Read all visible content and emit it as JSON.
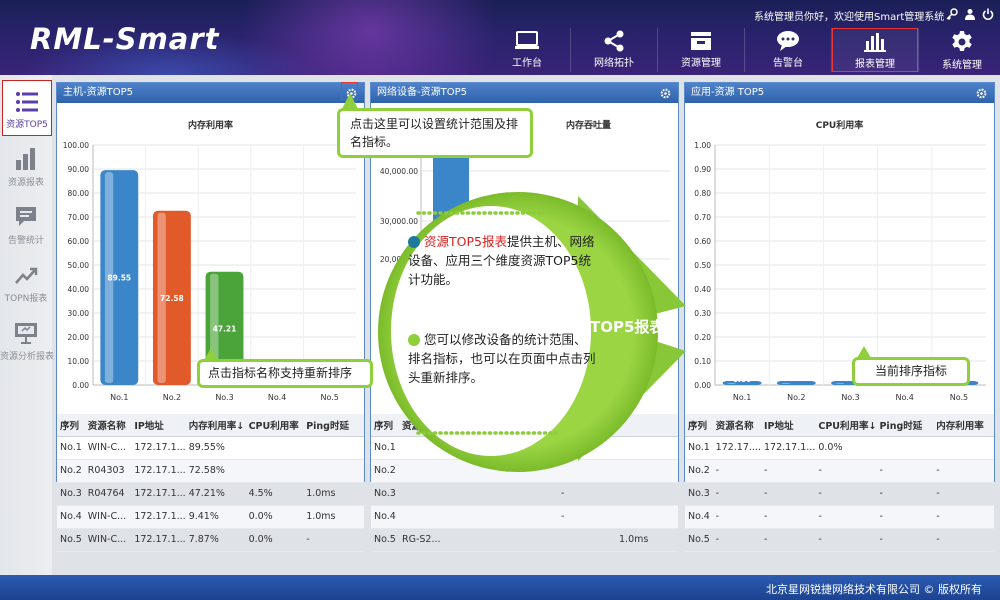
{
  "header": {
    "logo": "RML-Smart",
    "welcome": "系统管理员你好，欢迎使用Smart管理系统",
    "nav": [
      {
        "label": "工作台",
        "icon": "monitor-icon"
      },
      {
        "label": "网络拓扑",
        "icon": "share-icon"
      },
      {
        "label": "资源管理",
        "icon": "inbox-icon"
      },
      {
        "label": "告警台",
        "icon": "chat-icon"
      },
      {
        "label": "报表管理",
        "icon": "bar-chart-icon",
        "active": true
      },
      {
        "label": "系统管理",
        "icon": "gear-icon"
      }
    ]
  },
  "sidebar": {
    "items": [
      {
        "label": "资源TOP5",
        "icon": "list-icon",
        "active": true
      },
      {
        "label": "资源报表",
        "icon": "bar-chart-icon"
      },
      {
        "label": "告警统计",
        "icon": "message-icon"
      },
      {
        "label": "TOPN报表",
        "icon": "trend-icon"
      },
      {
        "label": "资源分析报表",
        "icon": "presentation-icon"
      }
    ]
  },
  "panels": {
    "host": {
      "title": "主机-资源TOP5",
      "chart_title": "内存利用率",
      "columns": [
        "序列",
        "资源名称",
        "IP地址",
        "内存利用率↓",
        "CPU利用率",
        "Ping时延"
      ],
      "rows": [
        [
          "No.1",
          "WIN-C...",
          "172.17.1...",
          "89.55%",
          "",
          ""
        ],
        [
          "No.2",
          "R04303",
          "172.17.1...",
          "72.58%",
          "",
          ""
        ],
        [
          "No.3",
          "R04764",
          "172.17.1...",
          "47.21%",
          "4.5%",
          "1.0ms"
        ],
        [
          "No.4",
          "WIN-C...",
          "172.17.1...",
          "9.41%",
          "0.0%",
          "1.0ms"
        ],
        [
          "No.5",
          "WIN-C...",
          "172.17.1...",
          "7.87%",
          "0.0%",
          "-"
        ]
      ]
    },
    "network": {
      "title": "网络设备-资源TOP5",
      "chart_title": "内存吞吐量",
      "columns": [
        "序列",
        "资源名称",
        "IP地址",
        "",
        "",
        ""
      ],
      "rows": [
        [
          "No.1",
          "",
          "",
          "",
          "",
          ""
        ],
        [
          "No.2",
          "",
          "",
          "",
          "",
          ""
        ],
        [
          "No.3",
          "",
          "",
          "",
          "-",
          ""
        ],
        [
          "No.4",
          "",
          "",
          "",
          "-",
          ""
        ],
        [
          "No.5",
          "RG-S2...",
          "",
          "",
          "",
          "1.0ms"
        ]
      ]
    },
    "app": {
      "title": "应用-资源 TOP5",
      "chart_title": "CPU利用率",
      "columns": [
        "序列",
        "资源名称",
        "IP地址",
        "CPU利用率↓",
        "Ping时延",
        "内存利用率"
      ],
      "rows": [
        [
          "No.1",
          "172.17....",
          "172.17.1...",
          "0.0%",
          "",
          ""
        ],
        [
          "No.2",
          "-",
          "-",
          "-",
          "-",
          "-"
        ],
        [
          "No.3",
          "-",
          "-",
          "-",
          "-",
          "-"
        ],
        [
          "No.4",
          "-",
          "-",
          "-",
          "-",
          "-"
        ],
        [
          "No.5",
          "-",
          "-",
          "-",
          "-",
          "-"
        ]
      ]
    }
  },
  "chart_data": [
    {
      "type": "bar",
      "title": "内存利用率",
      "categories": [
        "No.1",
        "No.2",
        "No.3",
        "No.4",
        "No.5"
      ],
      "values": [
        89.55,
        72.58,
        47.21,
        9.41,
        7.87
      ],
      "value_labels": [
        "89.55",
        "72.58",
        "47.21",
        "9.41",
        "7.87"
      ],
      "colors": [
        "#3b86c8",
        "#e05a2a",
        "#4aa43a",
        "#b9b62a",
        "#7aa040"
      ],
      "ylim": [
        0,
        100
      ],
      "yticks": [
        "0.00",
        "10.00",
        "20.00",
        "30.00",
        "40.00",
        "50.00",
        "60.00",
        "70.00",
        "80.00",
        "90.00",
        "100.00"
      ],
      "grid": true
    },
    {
      "type": "bar",
      "title": "内存吞吐量",
      "yticks_visible": [
        "40,000.00",
        "30,000.00",
        "20,000.00"
      ],
      "grid": true
    },
    {
      "type": "bar",
      "title": "CPU利用率",
      "categories": [
        "No.1",
        "No.2",
        "No.3",
        "No.4",
        "No.5"
      ],
      "values": [
        0.0,
        0,
        0,
        0,
        0
      ],
      "value_labels": [
        "0.00"
      ],
      "ylim": [
        0,
        1
      ],
      "yticks": [
        "0.00",
        "0.10",
        "0.20",
        "0.30",
        "0.40",
        "0.50",
        "0.60",
        "0.70",
        "0.80",
        "0.90",
        "1.00"
      ],
      "grid": true
    }
  ],
  "callouts": {
    "settings": "点击这里可以设置统计范围及排名指标。",
    "sort": "点击指标名称支持重新排序",
    "current": "当前排序指标",
    "bubble_highlight": "资源TOP5报表",
    "bubble_text1": "提供主机、网络设备、应用三个维度资源TOP5统计功能。",
    "bubble_text2": "您可以修改设备的统计范围、排名指标，也可以在页面中点击列头重新排序。",
    "banner": "资源TOP5报表"
  },
  "footer": "北京星网锐捷网络技术有限公司 © 版权所有",
  "colors": {
    "accent_green": "#8fcf3c",
    "panel_header": "#2e62ac",
    "active_border": "#dd2222"
  }
}
